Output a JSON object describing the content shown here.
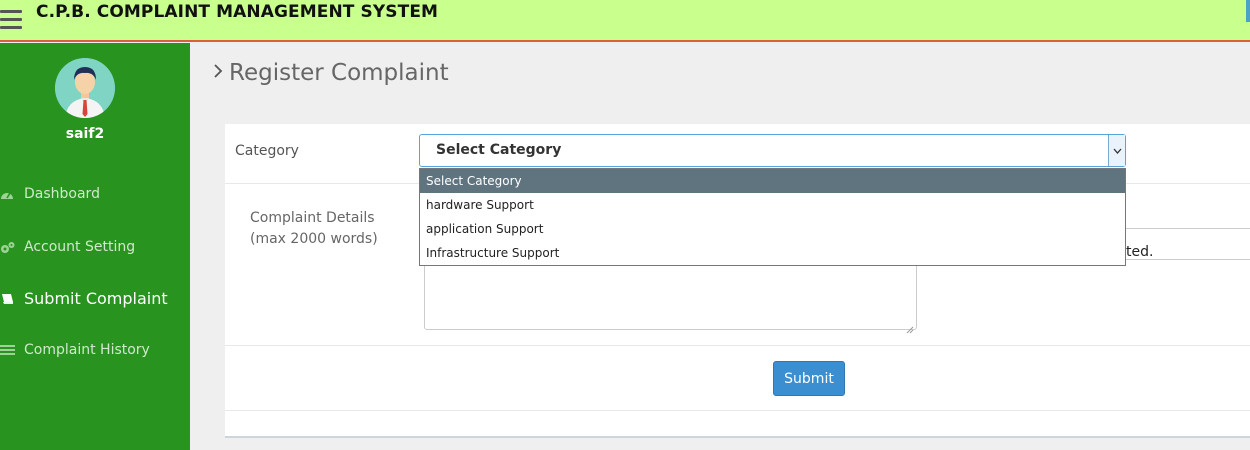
{
  "header": {
    "title": "C.P.B. COMPLAINT MANAGEMENT SYSTEM",
    "bg_color": "#c8ff8d",
    "border_color": "#d9603b"
  },
  "sidebar": {
    "bg_color": "#28931f",
    "username": "saif2",
    "items": [
      {
        "label": "Dashboard",
        "icon": "dashboard-icon"
      },
      {
        "label": "Account Setting",
        "icon": "gears-icon"
      },
      {
        "label": "Submit Complaint",
        "icon": "book-icon",
        "active": true
      },
      {
        "label": "Complaint History",
        "icon": "list-icon"
      }
    ]
  },
  "main": {
    "breadcrumb": "Register Complaint",
    "form": {
      "category_label": "Category",
      "category_selected": "Select Category",
      "details_label_line1": "Complaint Details",
      "details_label_line2": "(max 2000 words)",
      "right_partial_text": "ted.",
      "submit_label": "Submit"
    },
    "dropdown": {
      "options": [
        "Select Category",
        "hardware Support",
        "application Support",
        "Infrastructure Support"
      ],
      "selected_index": 0
    }
  }
}
